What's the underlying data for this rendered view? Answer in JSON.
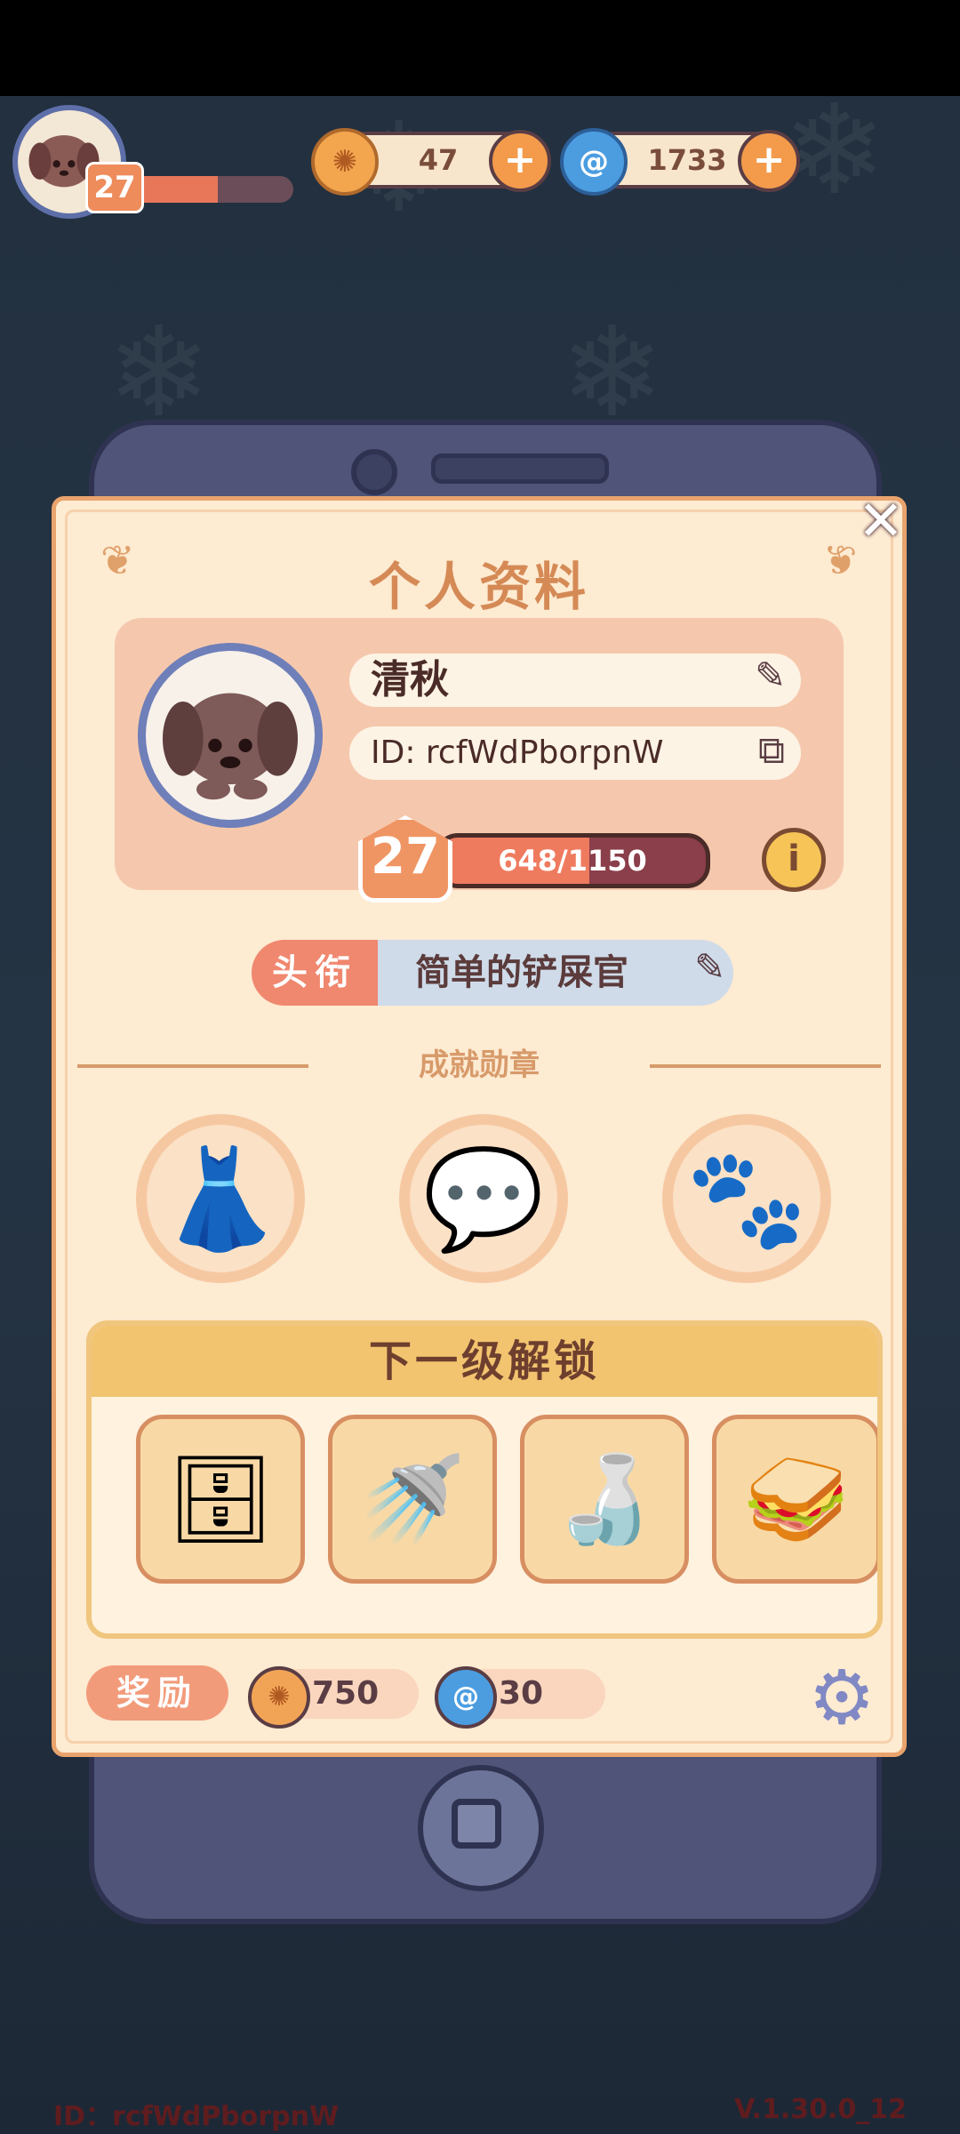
{
  "hud": {
    "level": "27",
    "xp_fraction": 0.55,
    "coins": "47",
    "gems": "1733",
    "coin_icon_glyph": "✺",
    "gem_icon_glyph": "@",
    "plus_glyph": "+"
  },
  "panel": {
    "title": "个人资料",
    "close_glyph": "✕",
    "flourish_glyph": "❦"
  },
  "profile": {
    "name": "清秋",
    "id_text": "ID: rcfWdPborpnW",
    "level": "27",
    "xp_text": "648/1150",
    "xp_fraction": 0.563,
    "info_glyph": "i",
    "edit_glyph": "✎",
    "copy_glyph": "⧉"
  },
  "title_row": {
    "tag": "头衔",
    "value": "简单的铲屎官",
    "edit_glyph": "✎"
  },
  "achievements": {
    "label": "成就勋章",
    "badges": [
      {
        "icon": "dress-icon",
        "glyph": "👗"
      },
      {
        "icon": "heart-message-icon",
        "glyph": "💬"
      },
      {
        "icon": "paw-icon",
        "glyph": "🐾"
      }
    ]
  },
  "unlock": {
    "title": "下一级解锁",
    "items": [
      {
        "icon": "cabinet-icon",
        "glyph": "🗄"
      },
      {
        "icon": "shower-icon",
        "glyph": "🚿"
      },
      {
        "icon": "sauce-bottles-icon",
        "glyph": "🍶"
      },
      {
        "icon": "sandwich-icon",
        "glyph": "🥪"
      }
    ]
  },
  "reward": {
    "label": "奖励",
    "coins": "750",
    "gems": "30",
    "settings_glyph": "⚙"
  },
  "footer": {
    "id_text": "ID：rcfWdPborpnW",
    "version": "V.1.30.0_12"
  },
  "colors": {
    "accent": "#ef9563",
    "panel_bg": "#fdebd2",
    "phone_frame": "#4f5478"
  }
}
